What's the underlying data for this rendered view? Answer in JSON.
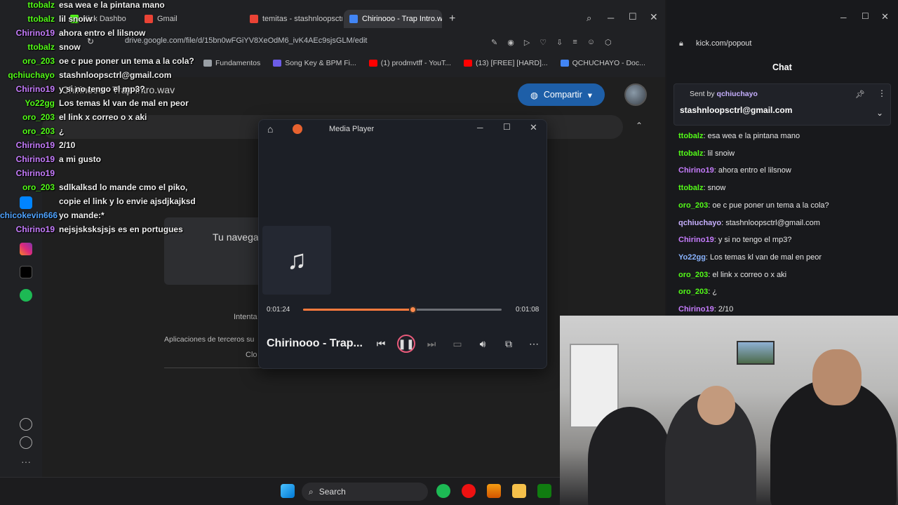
{
  "browser": {
    "tabs": [
      {
        "label": "Kick Dashbo",
        "color": "#53fc18"
      },
      {
        "label": "Gmail",
        "color": "#ea4335"
      },
      {
        "label": "temitas - stashnloopsctrl@",
        "color": "#ea4335"
      },
      {
        "label": "Chirinooo - Trap Intro.wav",
        "color": "#4285f4"
      }
    ],
    "url": "drive.google.com/file/d/15bn0wFGiYV8XeOdM6_ivK4AEc9sjsGLM/edit",
    "bookmarks": [
      {
        "label": "Fundamentos",
        "color": "#9aa0a6"
      },
      {
        "label": "Song Key & BPM Fi...",
        "color": "#6c5ce7"
      },
      {
        "label": "(1) prodmvtff - YouT...",
        "color": "#ff0000"
      },
      {
        "label": "(13) [FREE] [HARD]...",
        "color": "#ff0000"
      },
      {
        "label": "QCHUCHAYO - Doc...",
        "color": "#4285f4"
      }
    ]
  },
  "drive": {
    "file_name": "Chirinooo - Trap Intro.wav",
    "share_label": "Compartir",
    "browser_message": "Tu navega",
    "intenta": "Intenta",
    "apps_text": "Aplicaciones de terceros su",
    "clo_text": "Clo"
  },
  "overlay_chat": [
    {
      "user": "ttobalz",
      "msg": "esa wea e la pintana mano",
      "color": "#53fc18"
    },
    {
      "user": "ttobalz",
      "msg": "lil snoiw",
      "color": "#53fc18"
    },
    {
      "user": "Chirino19",
      "msg": "ahora entro el lilsnow",
      "color": "#c77dff"
    },
    {
      "user": "ttobalz",
      "msg": "snow",
      "color": "#53fc18"
    },
    {
      "user": "oro_203",
      "msg": "oe c pue poner un tema a la cola?",
      "color": "#53fc18"
    },
    {
      "user": "qchiuchayo",
      "msg": "stashnloopsctrl@gmail.com",
      "color": "#53fc18"
    },
    {
      "user": "Chirino19",
      "msg": "y si no tengo el mp3?",
      "color": "#c77dff"
    },
    {
      "user": "Yo22gg",
      "msg": "Los temas kl van de mal en peor",
      "color": "#53fc18"
    },
    {
      "user": "oro_203",
      "msg": "el link x correo o x aki",
      "color": "#53fc18"
    },
    {
      "user": "oro_203",
      "msg": "¿",
      "color": "#53fc18"
    },
    {
      "user": "Chirino19",
      "msg": "2/10",
      "color": "#c77dff"
    },
    {
      "user": "Chirino19",
      "msg": "a mi gusto",
      "color": "#c77dff"
    },
    {
      "user": "Chirino19",
      "msg": "",
      "color": "#c77dff"
    },
    {
      "user": "oro_203",
      "msg": "sdlkalksd lo mande cmo el piko,",
      "color": "#53fc18"
    },
    {
      "user": "",
      "msg": "copie el link y lo envie ajsdjkajksd",
      "color": "#53fc18"
    },
    {
      "user": "chicokevin666",
      "msg": "yo mande:*",
      "color": "#4fa3ff"
    },
    {
      "user": "Chirino19",
      "msg": "nejsjsksksjsjs es en portugues",
      "color": "#c77dff"
    }
  ],
  "player": {
    "app_title": "Media Player",
    "time_elapsed": "0:01:24",
    "time_remaining": "0:01:08",
    "progress_fraction": 0.55,
    "track_title": "Chirinooo - Trap..."
  },
  "kick": {
    "url": "kick.com/popout",
    "chat_title": "Chat",
    "pinned_sent_by": "Sent by",
    "pinned_user": "qchiuchayo",
    "pinned_message": "stashnloopsctrl@gmail.com",
    "messages": [
      {
        "user": "ttobalz",
        "msg": "esa wea e la pintana mano",
        "color": "#53fc18"
      },
      {
        "user": "ttobalz",
        "msg": "lil snoiw",
        "color": "#53fc18"
      },
      {
        "user": "Chirino19",
        "msg": "ahora entro el lilsnow",
        "color": "#c77dff"
      },
      {
        "user": "ttobalz",
        "msg": "snow",
        "color": "#53fc18"
      },
      {
        "user": "oro_203",
        "msg": "oe c pue poner un tema a la cola?",
        "color": "#53fc18"
      },
      {
        "user": "qchiuchayo",
        "msg": "stashnloopsctrl@gmail.com",
        "color": "#c7b0ff"
      },
      {
        "user": "Chirino19",
        "msg": "y si no tengo el mp3?",
        "color": "#c77dff"
      },
      {
        "user": "Yo22gg",
        "msg": "Los temas kl van de mal en peor",
        "color": "#8ab4ff"
      },
      {
        "user": "oro_203",
        "msg": "el link x correo o x aki",
        "color": "#53fc18"
      },
      {
        "user": "oro_203",
        "msg": "¿",
        "color": "#53fc18"
      },
      {
        "user": "Chirino19",
        "msg": "2/10",
        "color": "#c77dff"
      }
    ]
  },
  "taskbar": {
    "search_label": "Search"
  }
}
